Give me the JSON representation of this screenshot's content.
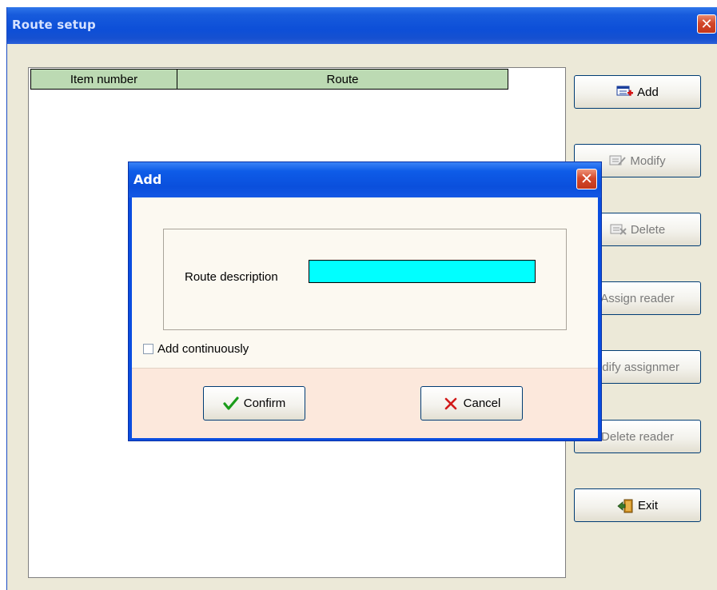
{
  "window": {
    "title": "Route setup",
    "close_glyph": "✕"
  },
  "grid": {
    "columns": [
      "Item number",
      "Route"
    ],
    "rows": []
  },
  "side_buttons": {
    "add": {
      "label": "Add",
      "icon": "add-record-icon",
      "enabled": true
    },
    "modify": {
      "label": "Modify",
      "icon": "edit-record-icon",
      "enabled": false
    },
    "delete": {
      "label": "Delete",
      "icon": "delete-record-icon",
      "enabled": false
    },
    "assign_reader": {
      "label": "Assign reader",
      "enabled": false
    },
    "modify_assignment": {
      "label": "odify assignmer",
      "enabled": false
    },
    "delete_reader": {
      "label": "Delete reader",
      "enabled": false
    },
    "exit": {
      "label": "Exit",
      "icon": "exit-door-icon",
      "enabled": true
    }
  },
  "dialog": {
    "title": "Add",
    "close_glyph": "✕",
    "route_label": "Route description",
    "route_value": "",
    "checkbox_label": "Add continuously",
    "checkbox_checked": false,
    "confirm_label": "Confirm",
    "cancel_label": "Cancel"
  },
  "colors": {
    "titlebar": "#0d4fd8",
    "header_bg": "#bcdab3",
    "input_bg": "#00ffff",
    "confirm_check": "#1a9c1a",
    "cancel_x": "#d11a1a"
  }
}
